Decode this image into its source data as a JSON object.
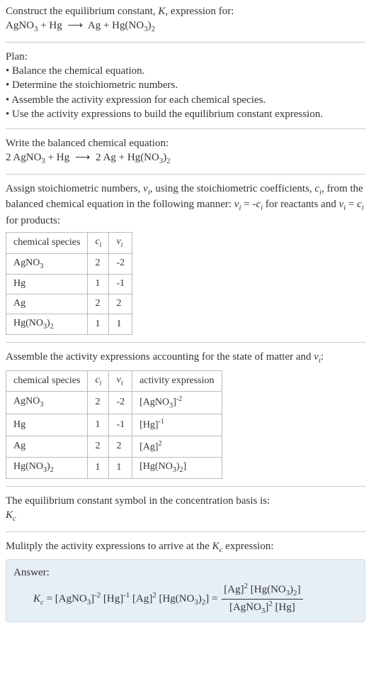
{
  "header": {
    "prompt_line1": "Construct the equilibrium constant, K, expression for:",
    "reaction_unbalanced": "AgNO3 + Hg ⟶ Ag + Hg(NO3)2"
  },
  "plan": {
    "title": "Plan:",
    "items": [
      "Balance the chemical equation.",
      "Determine the stoichiometric numbers.",
      "Assemble the activity expression for each chemical species.",
      "Use the activity expressions to build the equilibrium constant expression."
    ]
  },
  "balanced": {
    "intro": "Write the balanced chemical equation:",
    "equation": "2 AgNO3 + Hg ⟶ 2 Ag + Hg(NO3)2"
  },
  "stoich": {
    "intro1": "Assign stoichiometric numbers, νi, using the stoichiometric coefficients, ci, from the balanced chemical equation in the following manner: νi = -ci for reactants and νi = ci for products:",
    "headers": {
      "species": "chemical species",
      "ci": "ci",
      "vi": "νi"
    },
    "rows": [
      {
        "species": "AgNO3",
        "ci": "2",
        "vi": "-2"
      },
      {
        "species": "Hg",
        "ci": "1",
        "vi": "-1"
      },
      {
        "species": "Ag",
        "ci": "2",
        "vi": "2"
      },
      {
        "species": "Hg(NO3)2",
        "ci": "1",
        "vi": "1"
      }
    ]
  },
  "activity": {
    "intro": "Assemble the activity expressions accounting for the state of matter and νi:",
    "headers": {
      "species": "chemical species",
      "ci": "ci",
      "vi": "νi",
      "expr": "activity expression"
    },
    "rows": [
      {
        "species": "AgNO3",
        "ci": "2",
        "vi": "-2",
        "expr": "[AgNO3]^-2"
      },
      {
        "species": "Hg",
        "ci": "1",
        "vi": "-1",
        "expr": "[Hg]^-1"
      },
      {
        "species": "Ag",
        "ci": "2",
        "vi": "2",
        "expr": "[Ag]^2"
      },
      {
        "species": "Hg(NO3)2",
        "ci": "1",
        "vi": "1",
        "expr": "[Hg(NO3)2]"
      }
    ]
  },
  "symbol": {
    "line1": "The equilibrium constant symbol in the concentration basis is:",
    "kc": "Kc"
  },
  "multiply": {
    "line": "Mulitply the activity expressions to arrive at the Kc expression:"
  },
  "answer": {
    "label": "Answer:",
    "lhs": "Kc = [AgNO3]^-2 [Hg]^-1 [Ag]^2 [Hg(NO3)2] =",
    "frac_num": "[Ag]^2 [Hg(NO3)2]",
    "frac_den": "[AgNO3]^2 [Hg]"
  },
  "chart_data": {
    "type": "table",
    "tables": [
      {
        "title": "stoichiometric numbers",
        "columns": [
          "chemical species",
          "c_i",
          "ν_i"
        ],
        "rows": [
          [
            "AgNO3",
            2,
            -2
          ],
          [
            "Hg",
            1,
            -1
          ],
          [
            "Ag",
            2,
            2
          ],
          [
            "Hg(NO3)2",
            1,
            1
          ]
        ]
      },
      {
        "title": "activity expressions",
        "columns": [
          "chemical species",
          "c_i",
          "ν_i",
          "activity expression"
        ],
        "rows": [
          [
            "AgNO3",
            2,
            -2,
            "[AgNO3]^-2"
          ],
          [
            "Hg",
            1,
            -1,
            "[Hg]^-1"
          ],
          [
            "Ag",
            2,
            2,
            "[Ag]^2"
          ],
          [
            "Hg(NO3)2",
            1,
            1,
            "[Hg(NO3)2]"
          ]
        ]
      }
    ]
  }
}
